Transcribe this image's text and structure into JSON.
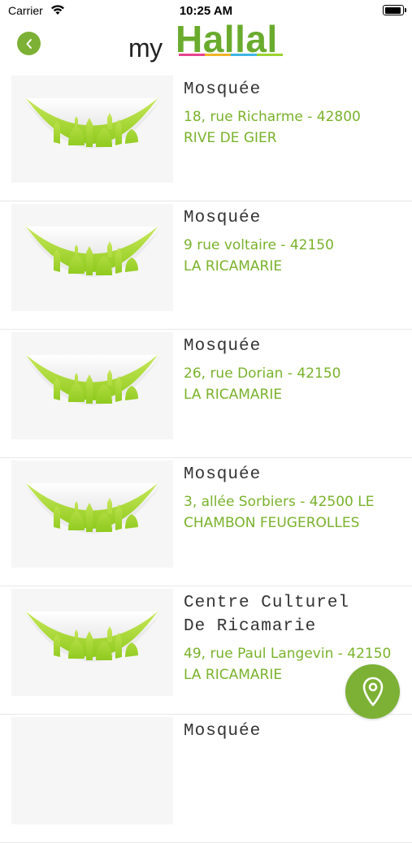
{
  "status_bar": {
    "carrier": "Carrier",
    "time": "10:25 AM",
    "battery_level": 0.9
  },
  "header": {
    "back_icon": "chevron-left-icon",
    "logo_my": "my",
    "logo_hallal": "Hallal",
    "brand_color": "#7cb135",
    "logo_stripe_colors": [
      "#e8438f",
      "#f0b429",
      "#3fb5e6",
      "#9bd32f"
    ]
  },
  "places": [
    {
      "title": "Mosquée",
      "address_line1": "18, rue Richarme - 42800",
      "address_line2": "RIVE DE GIER"
    },
    {
      "title": "Mosquée",
      "address_line1": "9 rue voltaire - 42150",
      "address_line2": "LA RICAMARIE"
    },
    {
      "title": "Mosquée",
      "address_line1": "26, rue Dorian - 42150",
      "address_line2": "LA RICAMARIE"
    },
    {
      "title": "Mosquée",
      "address_line1": "3, allée Sorbiers - 42500 LE",
      "address_line2": "CHAMBON FEUGEROLLES"
    },
    {
      "title_line1": "Centre Culturel",
      "title_line2": "De Ricamarie",
      "address_line1": "49, rue Paul Langevin - 42150",
      "address_line2": "LA RICAMARIE"
    },
    {
      "title": "Mosquée"
    }
  ],
  "map_button": {
    "icon": "map-pin-icon"
  }
}
